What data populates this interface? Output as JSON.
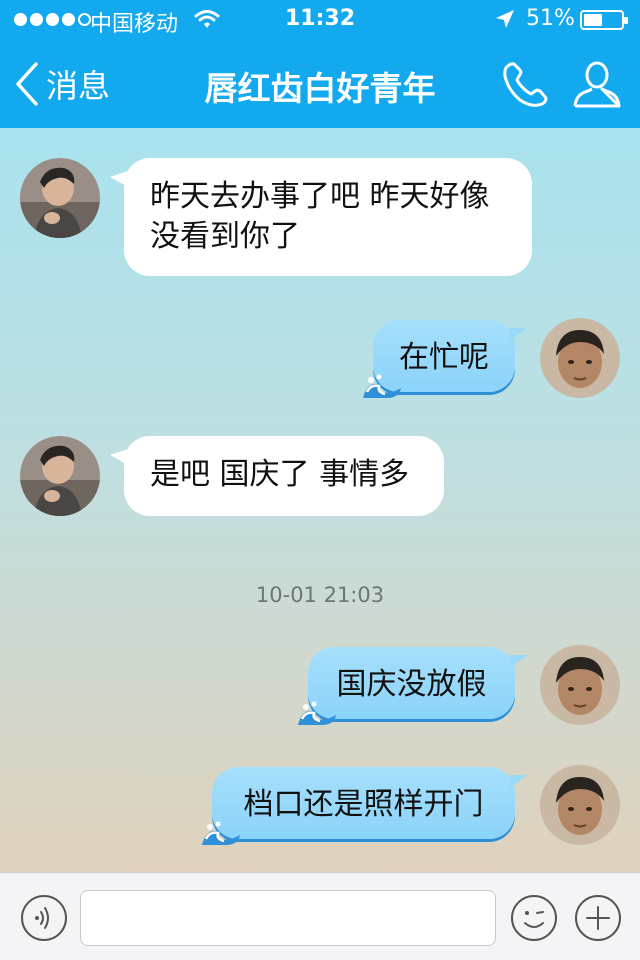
{
  "status_bar": {
    "carrier": "中国移动",
    "time": "11:32",
    "battery_percent_label": "51%",
    "battery_level": 0.51,
    "signal_bars_filled": 4,
    "signal_bars_total": 5,
    "icons": [
      "wifi-icon",
      "location-arrow-icon",
      "battery-icon"
    ]
  },
  "nav": {
    "back_label": "消息",
    "title": "唇红齿白好青年",
    "icons": [
      "back-chevron-icon",
      "phone-icon",
      "profile-icon"
    ]
  },
  "messages": [
    {
      "direction": "incoming",
      "text_line1": "昨天去办事了吧 昨天好像",
      "text_line2": "没看到你了"
    },
    {
      "direction": "outgoing",
      "text": "在忙呢"
    },
    {
      "direction": "incoming",
      "text": "是吧 国庆了 事情多"
    },
    {
      "direction": "outgoing",
      "text": "国庆没放假"
    },
    {
      "direction": "outgoing",
      "text": "档口还是照样开门"
    }
  ],
  "timestamp": "10-01 21:03",
  "input_bar": {
    "placeholder": "",
    "value": "",
    "icons": [
      "voice-icon",
      "emoji-icon",
      "plus-icon"
    ]
  },
  "colors": {
    "header": "#12a9ef",
    "outgoing_bubble": "#8bd3fa",
    "incoming_bubble": "#ffffff"
  }
}
